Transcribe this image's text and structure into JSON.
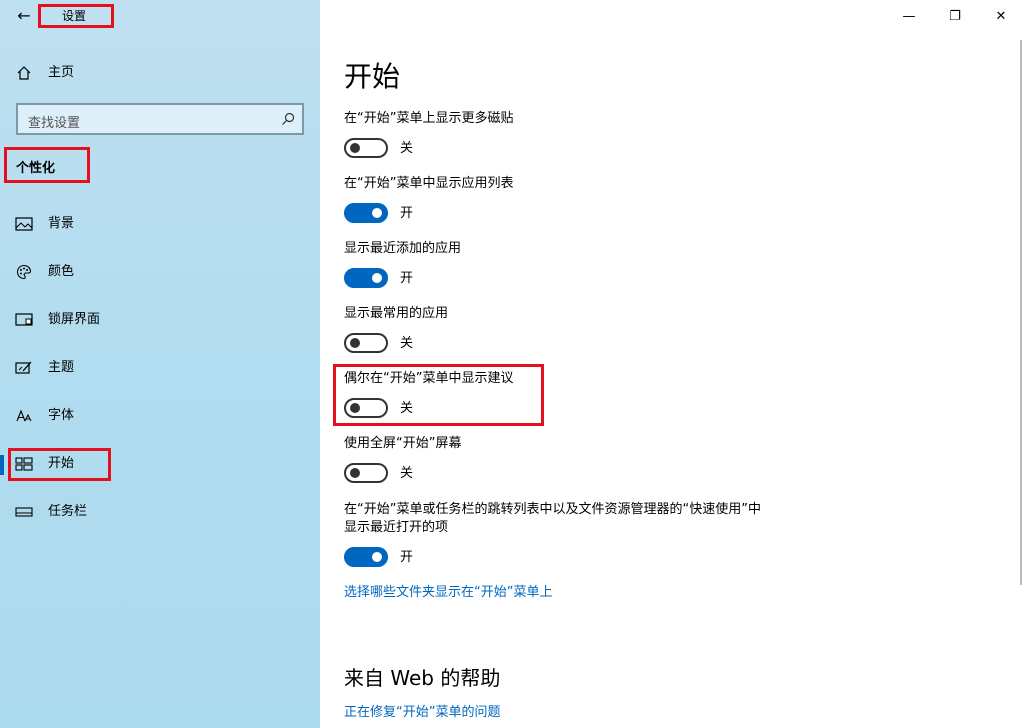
{
  "app": {
    "back_glyph": "←",
    "title": "设置"
  },
  "window_controls": {
    "minimize": "—",
    "maximize": "❐",
    "close": "✕"
  },
  "sidebar": {
    "home_label": "主页",
    "search_placeholder": "查找设置",
    "section_label": "个性化",
    "items": [
      {
        "label": "背景",
        "icon": "picture-icon"
      },
      {
        "label": "颜色",
        "icon": "palette-icon"
      },
      {
        "label": "锁屏界面",
        "icon": "lock-screen-icon"
      },
      {
        "label": "主题",
        "icon": "theme-icon"
      },
      {
        "label": "字体",
        "icon": "font-icon"
      },
      {
        "label": "开始",
        "icon": "start-icon",
        "selected": true
      },
      {
        "label": "任务栏",
        "icon": "taskbar-icon"
      }
    ]
  },
  "main": {
    "title": "开始",
    "settings": [
      {
        "label": "在“开始”菜单上显示更多磁贴",
        "state": "关",
        "on": false
      },
      {
        "label": "在“开始”菜单中显示应用列表",
        "state": "开",
        "on": true
      },
      {
        "label": "显示最近添加的应用",
        "state": "开",
        "on": true
      },
      {
        "label": "显示最常用的应用",
        "state": "关",
        "on": false
      },
      {
        "label": "偶尔在“开始”菜单中显示建议",
        "state": "关",
        "on": false
      },
      {
        "label": "使用全屏“开始”屏幕",
        "state": "关",
        "on": false
      },
      {
        "label_line1": "在“开始”菜单或任务栏的跳转列表中以及文件资源管理器的“快速使用”中",
        "label_line2": "显示最近打开的项",
        "state": "开",
        "on": true
      }
    ],
    "folders_link": "选择哪些文件夹显示在“开始”菜单上",
    "help_title": "来自 Web 的帮助",
    "help_link": "正在修复“开始”菜单的问题"
  },
  "colors": {
    "accent": "#0067c0",
    "highlight_box": "#e3101f"
  }
}
